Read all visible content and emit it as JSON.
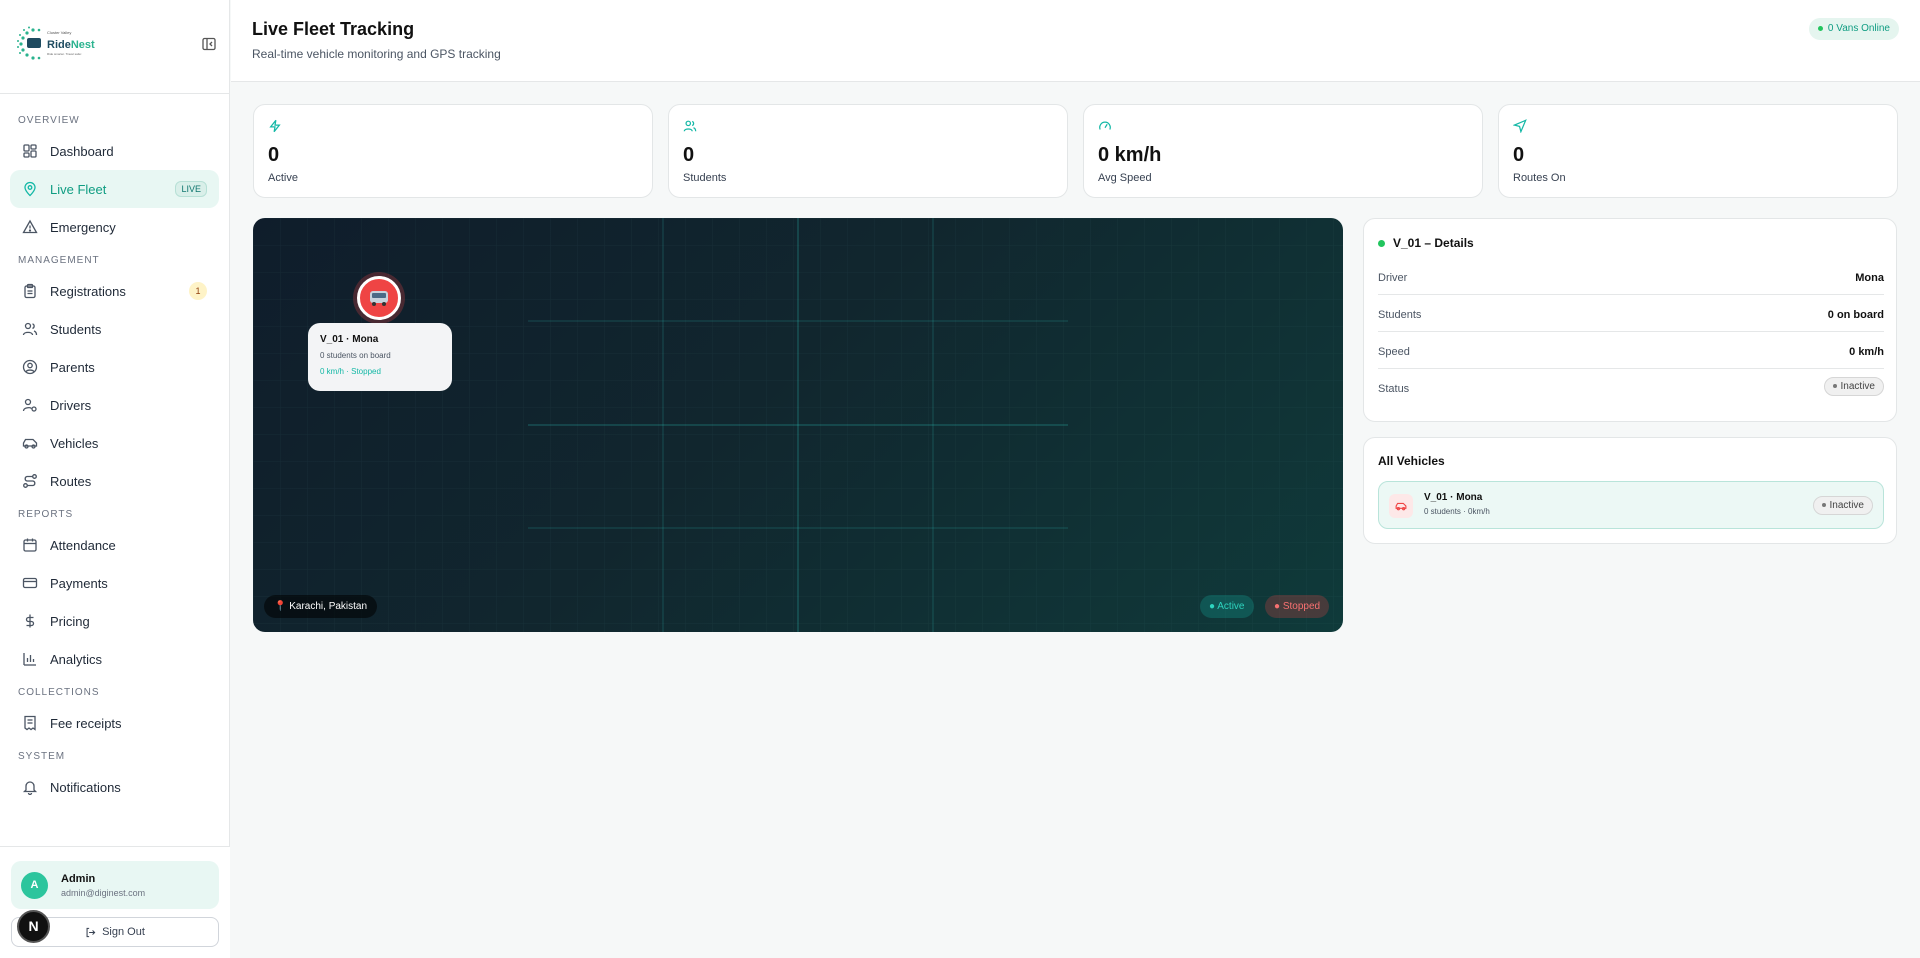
{
  "brand": {
    "logo_top": "Cluster Valley",
    "logo_name_1": "Ride",
    "logo_name_2": "Nest",
    "logo_tagline": "Ride smarter. Travel safer."
  },
  "sidebar": {
    "sections": [
      {
        "title": "OVERVIEW"
      },
      {
        "title": "MANAGEMENT"
      },
      {
        "title": "REPORTS"
      },
      {
        "title": "COLLECTIONS"
      },
      {
        "title": "SYSTEM"
      }
    ],
    "items": {
      "dashboard": "Dashboard",
      "live_fleet": "Live Fleet",
      "live_badge": "LIVE",
      "emergency": "Emergency",
      "registrations": "Registrations",
      "registrations_count": "1",
      "students": "Students",
      "parents": "Parents",
      "drivers": "Drivers",
      "vehicles": "Vehicles",
      "routes": "Routes",
      "attendance": "Attendance",
      "payments": "Payments",
      "pricing": "Pricing",
      "analytics": "Analytics",
      "fee_receipts": "Fee receipts",
      "notifications": "Notifications"
    },
    "user": {
      "initial": "A",
      "name": "Admin",
      "email": "admin@diginest.com",
      "signout": "Sign Out"
    },
    "n_badge": "N"
  },
  "header": {
    "title": "Live Fleet Tracking",
    "subtitle": "Real-time vehicle monitoring and GPS tracking",
    "online": "0 Vans Online"
  },
  "stats": [
    {
      "value": "0",
      "label": "Active"
    },
    {
      "value": "0",
      "label": "Students"
    },
    {
      "value": "0 km/h",
      "label": "Avg Speed"
    },
    {
      "value": "0",
      "label": "Routes On"
    }
  ],
  "map": {
    "popup_title": "V_01 · Mona",
    "popup_students": "0 students on board",
    "popup_status": "0 km/h · Stopped",
    "location": "📍 Karachi, Pakistan",
    "legend_active": "● Active",
    "legend_stopped": "● Stopped"
  },
  "details": {
    "title": "V_01 – Details",
    "rows": [
      {
        "key": "Driver",
        "value": "Mona"
      },
      {
        "key": "Students",
        "value": "0 on board"
      },
      {
        "key": "Speed",
        "value": "0 km/h"
      },
      {
        "key": "Status",
        "value": "Inactive"
      }
    ]
  },
  "vehicles": {
    "title": "All Vehicles",
    "list": [
      {
        "name": "V_01 · Mona",
        "sub": "0 students · 0km/h",
        "status": "Inactive"
      }
    ]
  },
  "colors": {
    "accent": "#14b8a6",
    "stopped": "#ef4444",
    "map_bg": "#0f2a30"
  }
}
